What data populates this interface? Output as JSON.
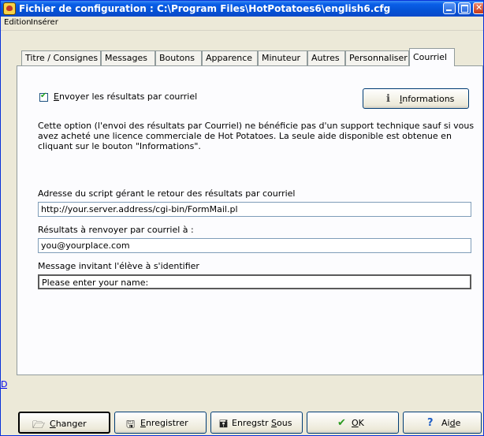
{
  "window": {
    "title": "Fichier de configuration : C:\\Program Files\\HotPotatoes6\\english6.cfg"
  },
  "menu": [
    "Edition",
    "Insérer"
  ],
  "tabs": [
    {
      "label": "Titre / Consignes",
      "active": false
    },
    {
      "label": "Messages",
      "active": false
    },
    {
      "label": "Boutons",
      "active": false
    },
    {
      "label": "Apparence",
      "active": false
    },
    {
      "label": "Minuteur",
      "active": false
    },
    {
      "label": "Autres",
      "active": false
    },
    {
      "label": "Personnaliser",
      "active": false
    },
    {
      "label": "Courriel",
      "active": true
    }
  ],
  "email_tab": {
    "send_checkbox": {
      "label_u": "E",
      "label_rest": "nvoyer les résultats par courriel",
      "checked": true
    },
    "info_button": {
      "label_u": "I",
      "label_rest": "nformations",
      "icon": "info-icon"
    },
    "description": "Cette option (l'envoi des résultats par Courriel) ne bénéficie pas d'un support technique sauf si vous avez acheté une licence commerciale de Hot Potatoes. La seule aide disponible est obtenue en cliquant sur le bouton \"Informations\".",
    "script_label": "Adresse du script gérant le retour des résultats par courriel",
    "script_value": "http://your.server.address/cgi-bin/FormMail.pl",
    "email_label": "Résultats à renvoyer par courriel à :",
    "email_value": "you@yourplace.com",
    "message_label": "Message invitant l'élève à s'identifier",
    "message_value": "Please enter your name:"
  },
  "side_link": "D",
  "buttons": {
    "change": {
      "label_u": "C",
      "label_rest": "hanger",
      "icon": "folder-open-icon"
    },
    "save": {
      "label_u": "E",
      "label_rest": "nregistrer",
      "icon": "floppy-disk-icon"
    },
    "save_as": {
      "label_pre": "Enregstr ",
      "label_u": "S",
      "label_rest": "ous",
      "icon": "floppy-save-as-icon"
    },
    "ok": {
      "label_u": "O",
      "label_rest": "K",
      "icon": "checkmark-icon",
      "icon_color": "#2a9a1f"
    },
    "help": {
      "label_pre": "Ai",
      "label_u": "d",
      "label_rest": "e",
      "icon": "question-mark-icon",
      "icon_color": "#1f5fc6"
    }
  }
}
